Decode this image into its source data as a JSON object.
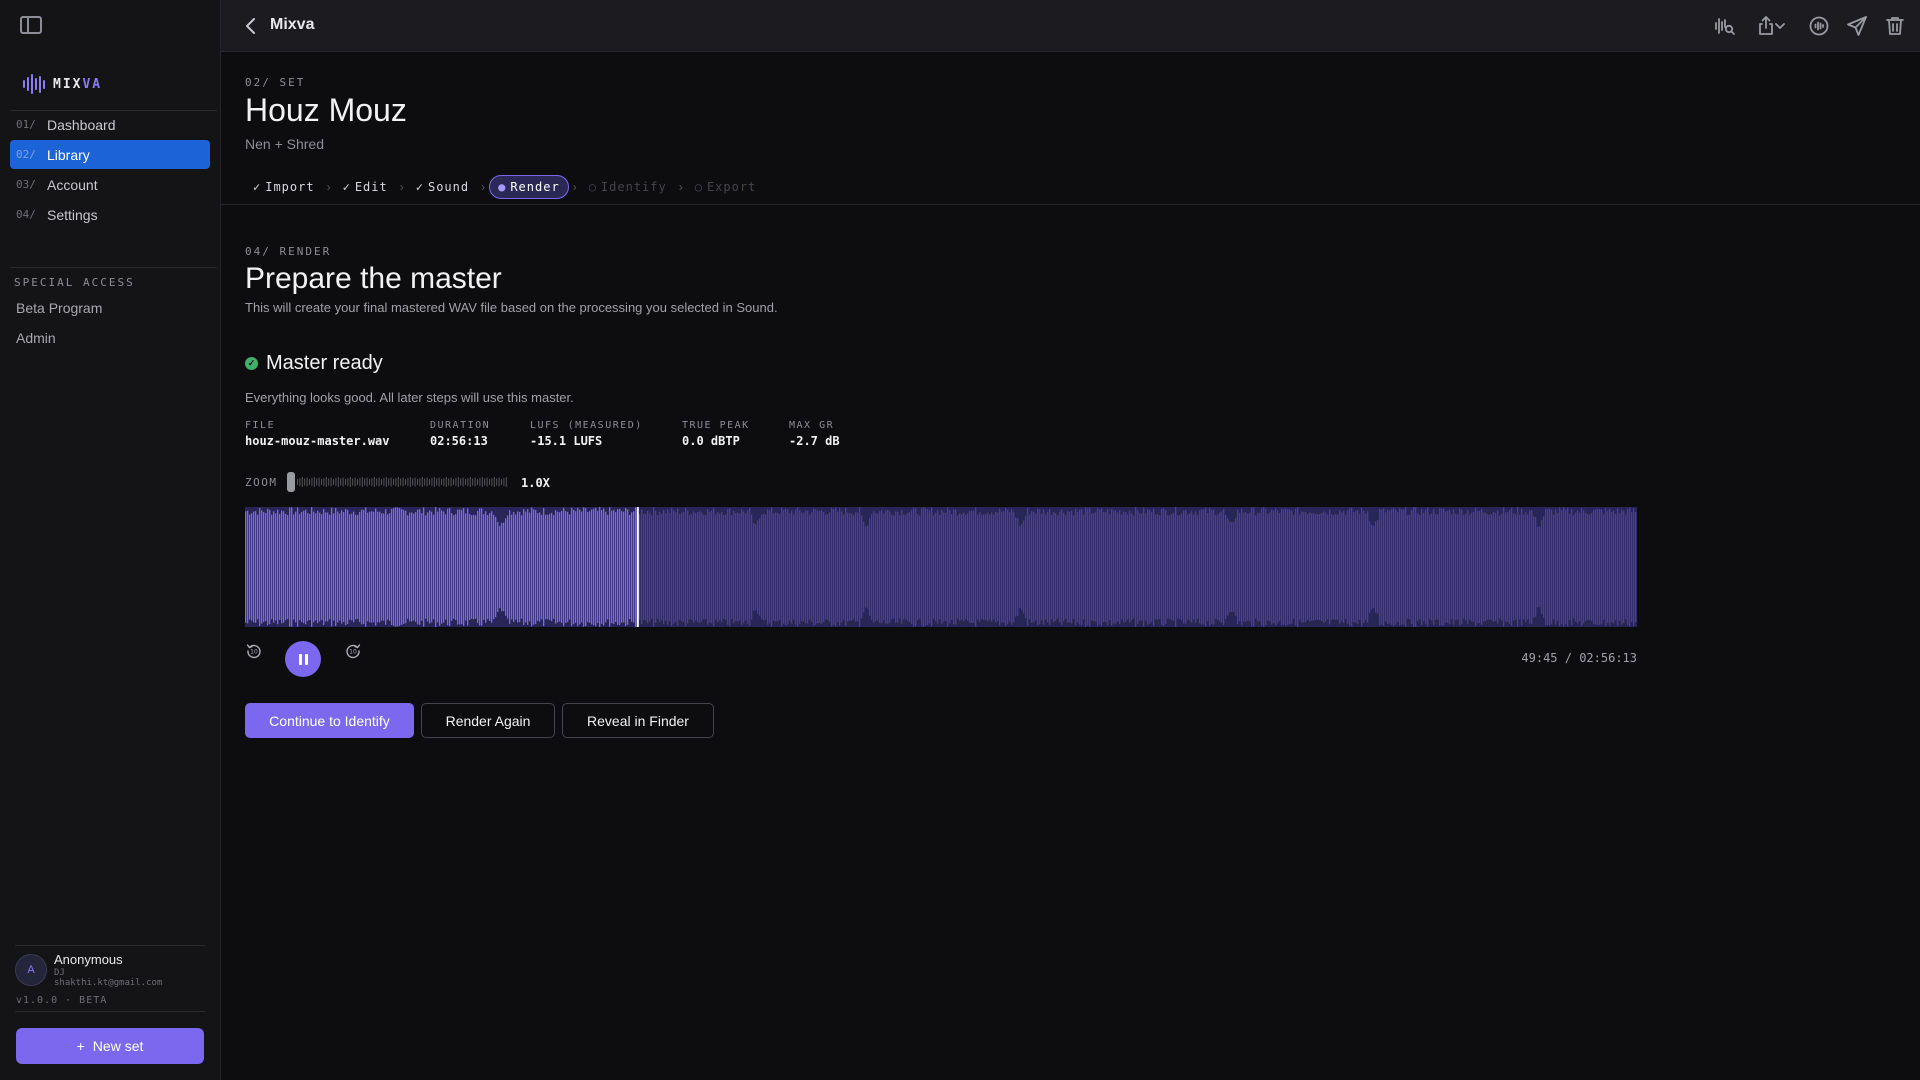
{
  "window": {
    "title": "Mixva"
  },
  "brand": {
    "left": "MIX",
    "right": "VA"
  },
  "colors": {
    "accent": "#7b68ee",
    "nav_active": "#1d63d8",
    "success": "#3fb06a"
  },
  "sidebar": {
    "nav": [
      {
        "num": "01/",
        "label": "Dashboard",
        "active": false
      },
      {
        "num": "02/",
        "label": "Library",
        "active": true
      },
      {
        "num": "03/",
        "label": "Account",
        "active": false
      },
      {
        "num": "04/",
        "label": "Settings",
        "active": false
      }
    ],
    "special_access": {
      "heading": "SPECIAL ACCESS",
      "items": [
        "Beta Program",
        "Admin"
      ]
    },
    "user": {
      "initial": "A",
      "name": "Anonymous",
      "role": "DJ",
      "email": "shakthi.kt@gmail.com"
    },
    "version": "v1.0.0 · BETA",
    "new_set": {
      "icon": "+",
      "label": "New set"
    }
  },
  "topbar": {
    "icons": [
      "waveform-search-icon",
      "share-icon",
      "chevron-down-icon",
      "waveform-circle-icon",
      "send-icon",
      "trash-icon"
    ]
  },
  "header": {
    "eyebrow": "02/ SET",
    "title": "Houz Mouz",
    "subtitle": "Nen + Shred"
  },
  "steps": [
    {
      "mark": "✓",
      "label": "Import",
      "state": "done"
    },
    {
      "mark": "✓",
      "label": "Edit",
      "state": "done"
    },
    {
      "mark": "✓",
      "label": "Sound",
      "state": "done"
    },
    {
      "mark": "●",
      "label": "Render",
      "state": "active"
    },
    {
      "mark": "○",
      "label": "Identify",
      "state": "pending"
    },
    {
      "mark": "○",
      "label": "Export",
      "state": "pending"
    }
  ],
  "render": {
    "eyebrow": "04/ RENDER",
    "title": "Prepare the master",
    "description": "This will create your final mastered WAV file based on the processing you selected in Sound.",
    "status": {
      "title": "Master ready",
      "description": "Everything looks good. All later steps will use this master."
    },
    "meta": [
      {
        "key": "FILE",
        "value": "houz-mouz-master.wav"
      },
      {
        "key": "DURATION",
        "value": "02:56:13"
      },
      {
        "key": "LUFS (MEASURED)",
        "value": "-15.1 LUFS"
      },
      {
        "key": "TRUE PEAK",
        "value": "0.0 dBTP"
      },
      {
        "key": "MAX GR",
        "value": "-2.7 dB"
      }
    ],
    "zoom": {
      "label": "ZOOM",
      "value": "1.0X"
    },
    "playback": {
      "progress": 0.2822,
      "time_current": "49:45",
      "time_total": "02:56:13",
      "playing": true
    },
    "actions": {
      "continue": "Continue to Identify",
      "render_again": "Render Again",
      "reveal": "Reveal in Finder"
    }
  }
}
